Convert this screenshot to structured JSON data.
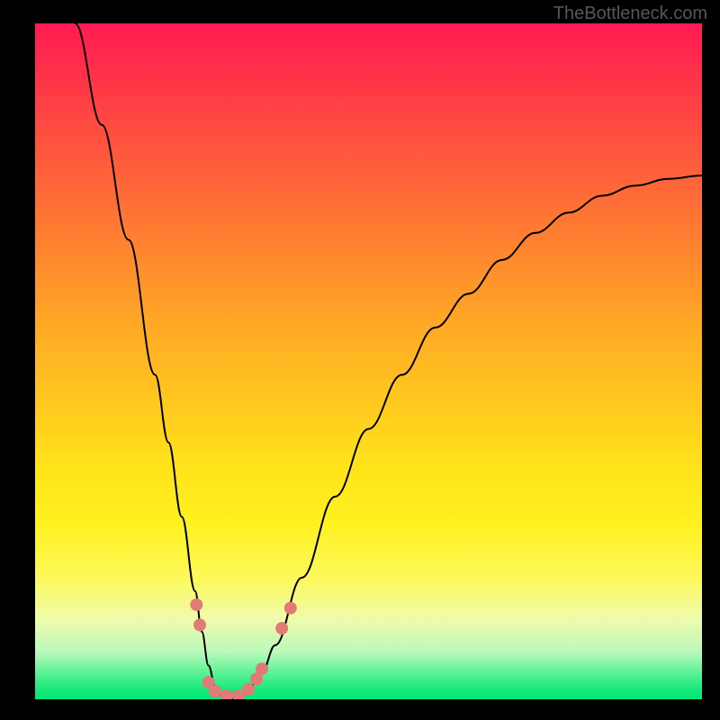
{
  "watermark": "TheBottleneck.com",
  "chart_data": {
    "type": "line",
    "title": "",
    "xlabel": "",
    "ylabel": "",
    "xlim": [
      0,
      100
    ],
    "ylim": [
      0,
      100
    ],
    "series": [
      {
        "name": "curve",
        "x": [
          6,
          10,
          14,
          18,
          20,
          22,
          24,
          25,
          26,
          27,
          28,
          29,
          30,
          31,
          32,
          34,
          36,
          40,
          45,
          50,
          55,
          60,
          65,
          70,
          75,
          80,
          85,
          90,
          95,
          100
        ],
        "y": [
          100,
          85,
          68,
          48,
          38,
          27,
          16,
          10,
          5,
          2,
          0.5,
          0,
          0,
          0.5,
          1.5,
          4,
          8,
          18,
          30,
          40,
          48,
          55,
          60,
          65,
          69,
          72,
          74.5,
          76,
          77,
          77.5
        ]
      }
    ],
    "markers": [
      {
        "x": 24.2,
        "y": 14.0,
        "r": 7
      },
      {
        "x": 24.7,
        "y": 11.0,
        "r": 7
      },
      {
        "x": 26.0,
        "y": 2.5,
        "r": 7
      },
      {
        "x": 27.0,
        "y": 1.2,
        "r": 7
      },
      {
        "x": 28.7,
        "y": 0.5,
        "r": 7
      },
      {
        "x": 30.5,
        "y": 0.5,
        "r": 7
      },
      {
        "x": 32.0,
        "y": 1.5,
        "r": 7
      },
      {
        "x": 33.2,
        "y": 3.0,
        "r": 7
      },
      {
        "x": 34.0,
        "y": 4.5,
        "r": 7
      },
      {
        "x": 37.0,
        "y": 10.5,
        "r": 7
      },
      {
        "x": 38.3,
        "y": 13.5,
        "r": 7
      }
    ],
    "colors": {
      "gradient_top": "#ff1a52",
      "gradient_bottom": "#00e776",
      "marker": "#e27a78",
      "curve": "#000000"
    }
  }
}
